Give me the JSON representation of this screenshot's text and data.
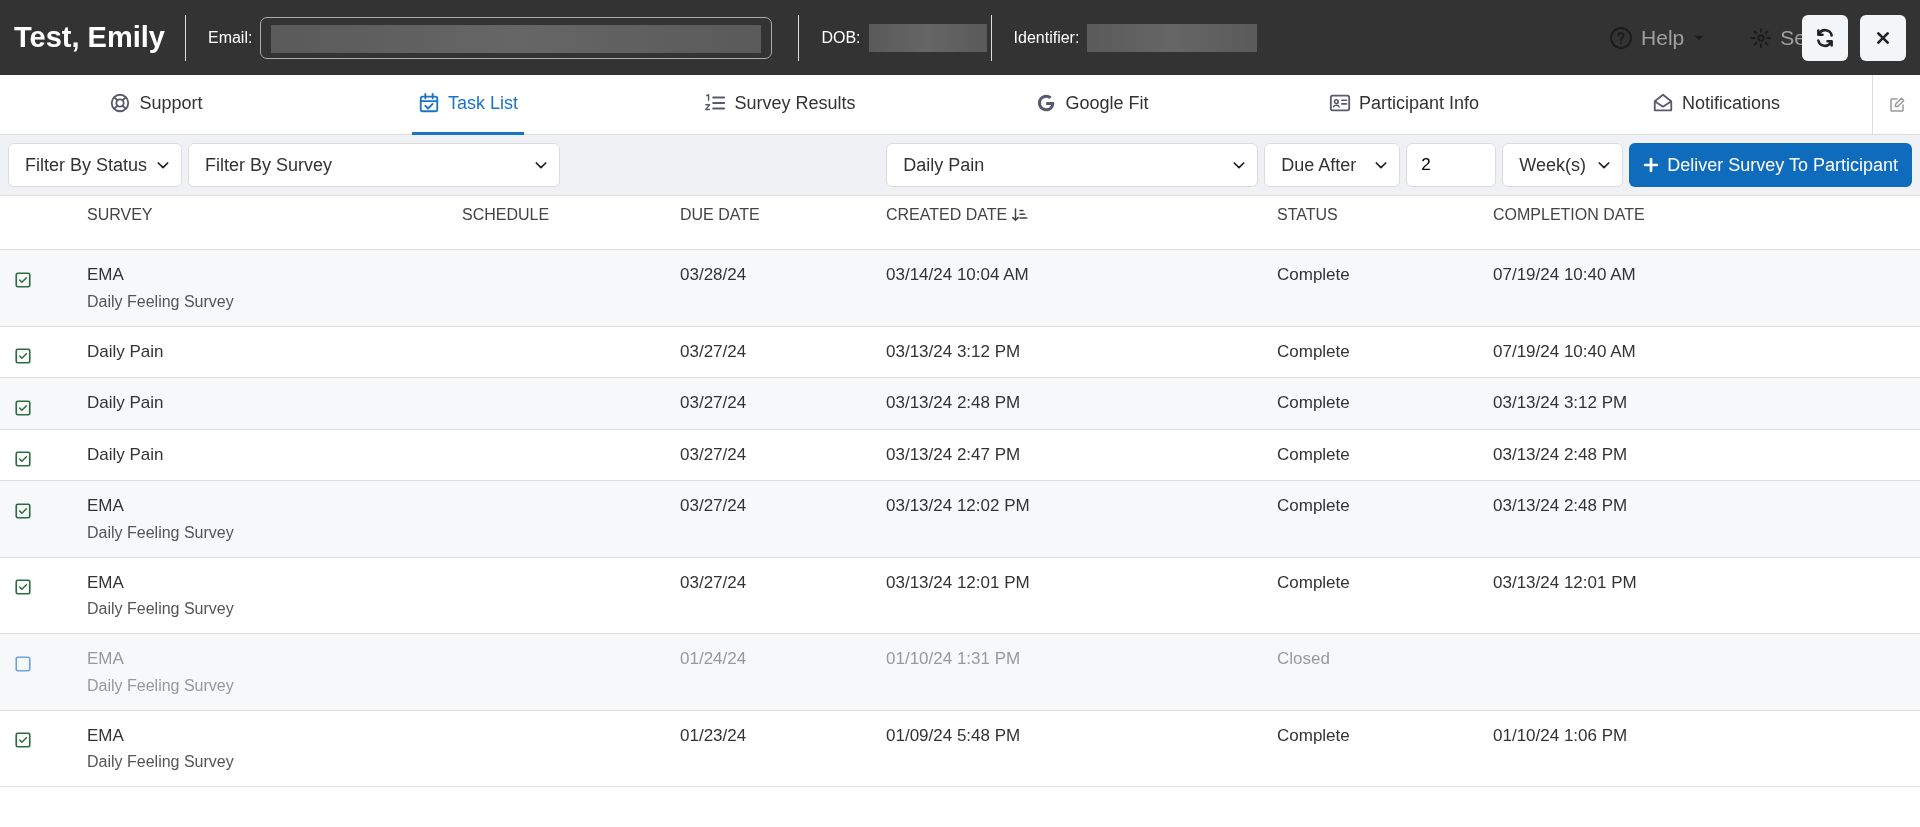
{
  "header": {
    "participant_name": "Test, Emily",
    "email_label": "Email:",
    "dob_label": "DOB:",
    "identifier_label": "Identifier:",
    "help_label": "Help",
    "settings_label": "Se"
  },
  "tabs": [
    {
      "label": "Support",
      "kind": "support",
      "selected": false
    },
    {
      "label": "Task List",
      "kind": "calendar",
      "selected": true
    },
    {
      "label": "Survey Results",
      "kind": "list",
      "selected": false
    },
    {
      "label": "Google Fit",
      "kind": "google",
      "selected": false
    },
    {
      "label": "Participant Info",
      "kind": "card",
      "selected": false
    },
    {
      "label": "Notifications",
      "kind": "envelope",
      "selected": false
    }
  ],
  "toolbar": {
    "status_filter": "Filter By Status",
    "survey_filter": "Filter By Survey",
    "survey_select": "Daily Pain",
    "due_select": "Due After",
    "due_amount": "2",
    "unit_select": "Week(s)",
    "deliver_button": "Deliver Survey To Participant"
  },
  "table": {
    "columns": [
      "SURVEY",
      "SCHEDULE",
      "DUE DATE",
      "CREATED DATE",
      "STATUS",
      "COMPLETION DATE"
    ],
    "rows": [
      {
        "checked": true,
        "disabled": false,
        "survey": "EMA",
        "subtitle": "Daily Feeling Survey",
        "due": "03/28/24",
        "created": "03/14/24 10:04 AM",
        "status": "Complete",
        "completed": "07/19/24 10:40 AM"
      },
      {
        "checked": true,
        "disabled": false,
        "survey": "Daily Pain",
        "due": "03/27/24",
        "created": "03/13/24 3:12 PM",
        "status": "Complete",
        "completed": "07/19/24 10:40 AM"
      },
      {
        "checked": true,
        "disabled": false,
        "survey": "Daily Pain",
        "due": "03/27/24",
        "created": "03/13/24 2:48 PM",
        "status": "Complete",
        "completed": "03/13/24 3:12 PM"
      },
      {
        "checked": true,
        "disabled": false,
        "survey": "Daily Pain",
        "due": "03/27/24",
        "created": "03/13/24 2:47 PM",
        "status": "Complete",
        "completed": "03/13/24 2:48 PM"
      },
      {
        "checked": true,
        "disabled": false,
        "survey": "EMA",
        "subtitle": "Daily Feeling Survey",
        "due": "03/27/24",
        "created": "03/13/24 12:02 PM",
        "status": "Complete",
        "completed": "03/13/24 2:48 PM"
      },
      {
        "checked": true,
        "disabled": false,
        "survey": "EMA",
        "subtitle": "Daily Feeling Survey",
        "due": "03/27/24",
        "created": "03/13/24 12:01 PM",
        "status": "Complete",
        "completed": "03/13/24 12:01 PM"
      },
      {
        "checked": false,
        "disabled": true,
        "survey": "EMA",
        "subtitle": "Daily Feeling Survey",
        "due": "01/24/24",
        "created": "01/10/24 1:31 PM",
        "status": "Closed"
      },
      {
        "checked": true,
        "disabled": false,
        "survey": "EMA",
        "subtitle": "Daily Feeling Survey",
        "due": "01/23/24",
        "created": "01/09/24 5:48 PM",
        "status": "Complete",
        "completed": "01/10/24 1:06 PM"
      }
    ]
  }
}
